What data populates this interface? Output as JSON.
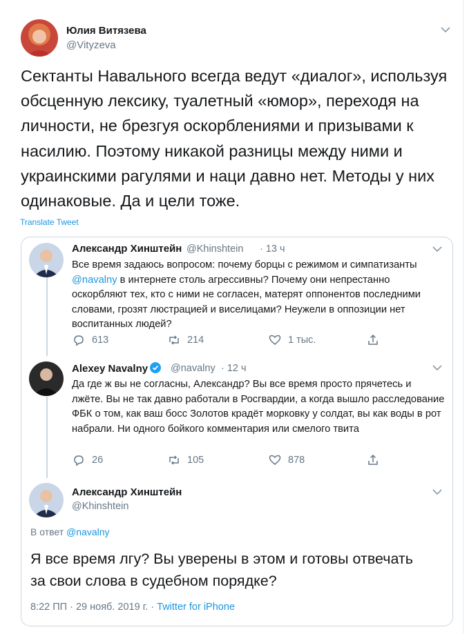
{
  "tweet": {
    "author_name": "Юлия Витязева",
    "author_handle": "@Vityzeva",
    "text": "Сектанты Навального всегда ведут «диалог», используя обсценную лексику, туалетный «юмор», переходя на личности, не брезгуя оскорблениями и призывами к насилию. Поэтому никакой разницы между ними и украинскими рагулями и наци давно нет. Методы у них одинаковые. Да и цели тоже.",
    "translate_label": "Translate Tweet"
  },
  "quoted": {
    "first": {
      "author_name": "Александр Хинштейн",
      "author_handle": "@Khinshtein",
      "time": "· 13 ч",
      "text_before": "Все время задаюсь вопросом: почему борцы с режимом и симпатизанты ",
      "mention": "@navalny",
      "text_after": " в интернете столь агрессивны? Почему они непрестанно оскорбляют тех, кто с ними не согласен, матерят оппонентов последними словами, грозят люстрацией и виселицами? Неужели в оппозиции нет воспитанных людей?",
      "replies": "613",
      "retweets": "214",
      "likes": "1 тыс."
    },
    "second": {
      "author_name": "Alexey Navalny",
      "author_handle": "@navalny",
      "time": "· 12 ч",
      "text": "Да где ж вы не согласны, Александр? Вы все время просто прячетесь и лжёте. Вы не так давно работали в Росгвардии, а когда вышло расследование ФБК о том, как ваш босс Золотов крадёт морковку у солдат, вы как воды в рот набрали. Ни одного бойкого комментария или смелого твита",
      "replies": "26",
      "retweets": "105",
      "likes": "878"
    },
    "third": {
      "author_name": "Александр Хинштейн",
      "author_handle": "@Khinshtein",
      "reply_prefix": "В ответ ",
      "reply_mention": "@navalny",
      "text": "Я все время лгу? Вы уверены в этом и готовы отвечать за свои слова в судебном порядке?",
      "timestamp": "8:22 ПП · 29 нояб. 2019 г. · ",
      "source": "Twitter for iPhone"
    }
  },
  "colors": {
    "accent": "#1b95e0",
    "muted": "#657786",
    "border": "#ccd6dd"
  }
}
